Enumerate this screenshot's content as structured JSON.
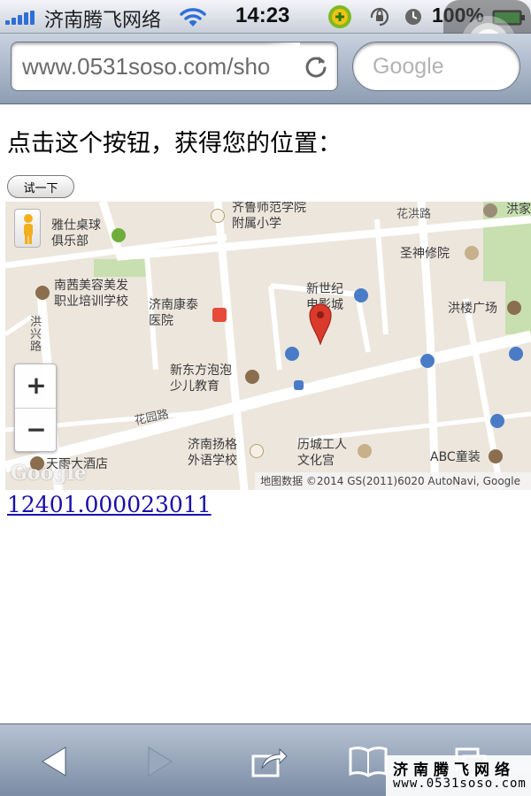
{
  "status_bar": {
    "carrier": "济南腾飞网络",
    "time": "14:23",
    "battery": "100%"
  },
  "address_bar": {
    "url": "www.0531soso.com/sho",
    "search_placeholder": "Google"
  },
  "page": {
    "prompt": "点击这个按钮，获得您的位置：",
    "button_label": "试一下",
    "coords_text": "12401.000023011"
  },
  "map": {
    "labels": {
      "qilu": "齐鲁师范学院\n附属小学",
      "yashi": "雅仕桌球\n俱乐部",
      "honghong_road": "花洪路",
      "hongjia": "洪家",
      "shengshen": "圣神修院",
      "nanxi": "南茜美容美发\n职业培训学校",
      "kangtai": "济南康泰\n医院",
      "xinshiji": "新世纪\n电影城",
      "honglou": "洪楼广场",
      "hongxing_road": "洪兴路",
      "xindongfang": "新东方泡泡\n少儿教育",
      "huayuan_road": "花园路",
      "yangge": "济南扬格\n外语学校",
      "licheng": "历城工人\n文化宫",
      "abc": "ABC童装",
      "tianyu": "天雨大酒店"
    },
    "zoom_in": "+",
    "zoom_out": "−",
    "watermark_logo": "Google",
    "attribution": "地图数据 ©2014 GS(2011)6020 AutoNavi, Google"
  },
  "watermark": {
    "line1": "济南腾飞网络",
    "line2": "www.0531soso.com"
  },
  "colors": {
    "link": "#1a0dab",
    "marker": "#d93a2b",
    "map_bg": "#ece6dd",
    "park": "#c8dfb0"
  }
}
